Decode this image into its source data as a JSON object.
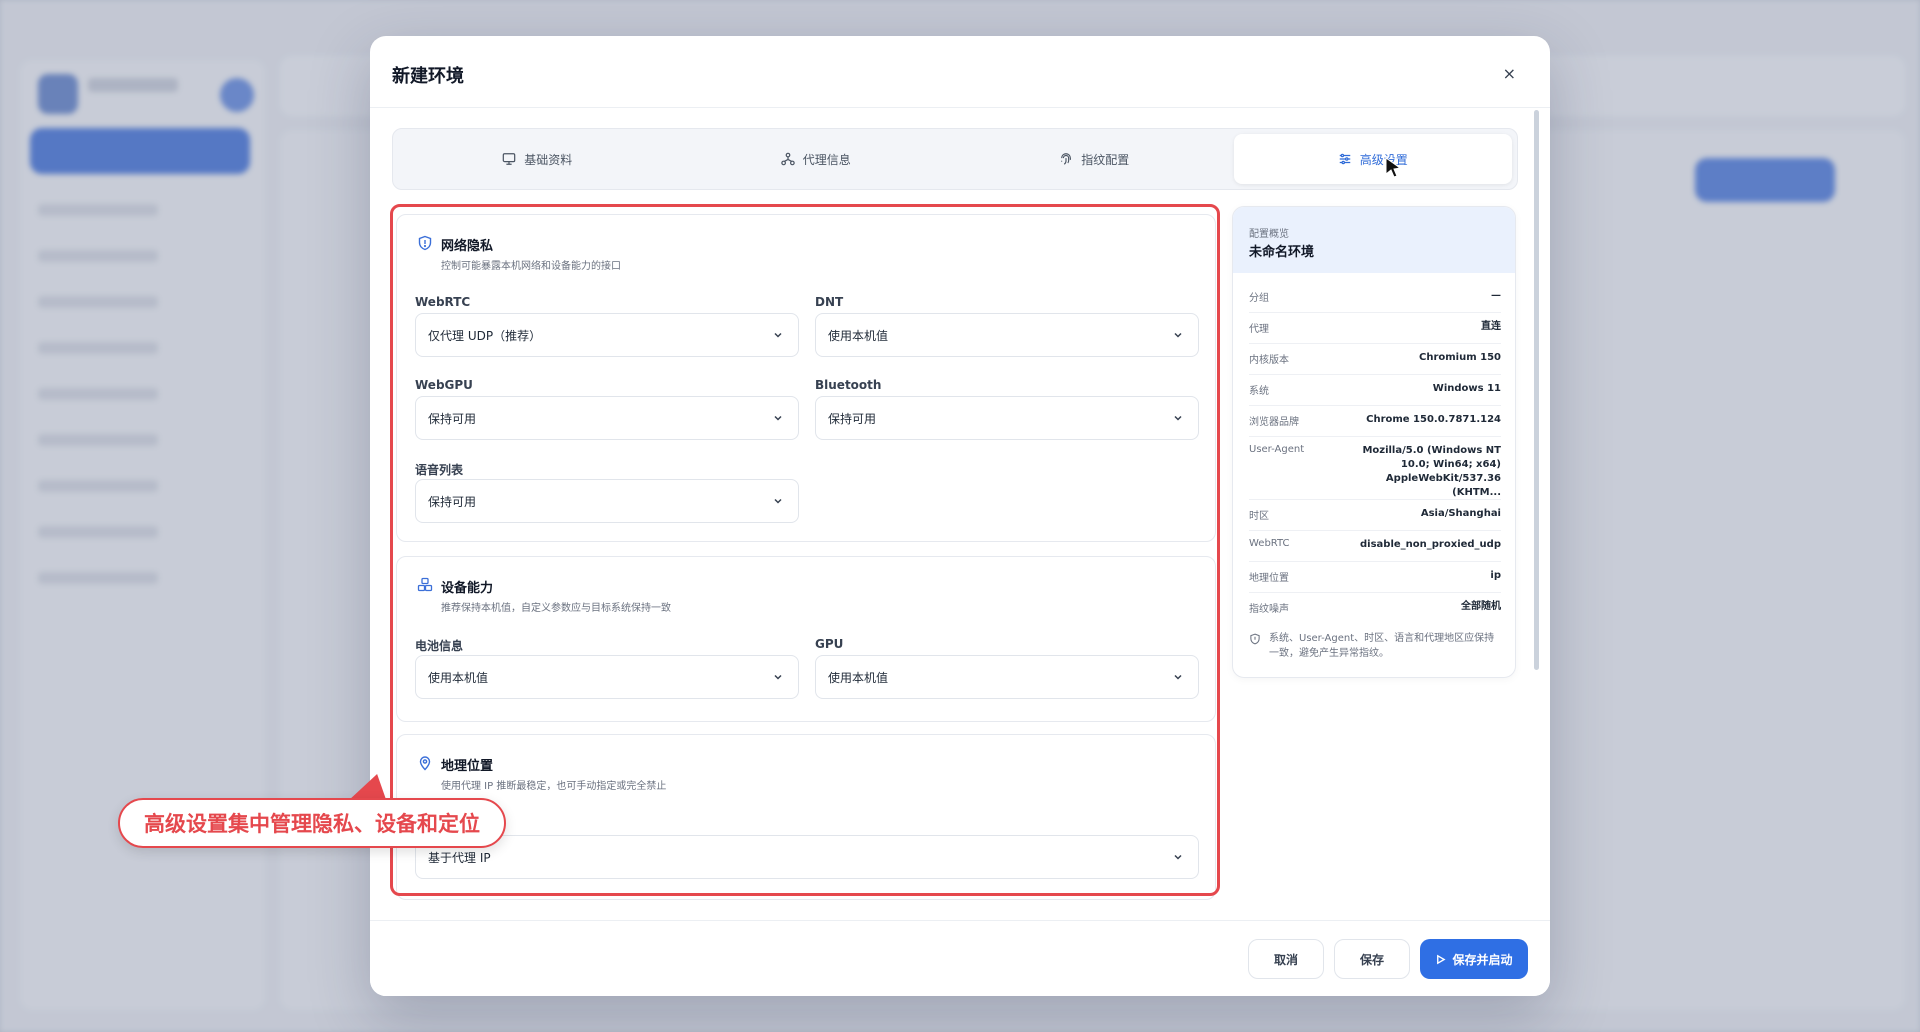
{
  "modal": {
    "title": "新建环境",
    "close_label": "×"
  },
  "tabs": [
    {
      "label": "基础资料",
      "icon": "monitor-icon"
    },
    {
      "label": "代理信息",
      "icon": "network-icon"
    },
    {
      "label": "指纹配置",
      "icon": "fingerprint-icon"
    },
    {
      "label": "高级设置",
      "icon": "sliders-icon",
      "active": true
    }
  ],
  "sections": {
    "privacy": {
      "title": "网络隐私",
      "desc": "控制可能暴露本机网络和设备能力的接口",
      "fields": {
        "webrtc": {
          "label": "WebRTC",
          "value": "仅代理 UDP（推荐）"
        },
        "dnt": {
          "label": "DNT",
          "value": "使用本机值"
        },
        "webgpu": {
          "label": "WebGPU",
          "value": "保持可用"
        },
        "bluetooth": {
          "label": "Bluetooth",
          "value": "保持可用"
        },
        "voices": {
          "label": "语音列表",
          "value": "保持可用"
        }
      }
    },
    "device": {
      "title": "设备能力",
      "desc": "推荐保持本机值，自定义参数应与目标系统保持一致",
      "fields": {
        "battery": {
          "label": "电池信息",
          "value": "使用本机值"
        },
        "gpu": {
          "label": "GPU",
          "value": "使用本机值"
        }
      }
    },
    "geo": {
      "title": "地理位置",
      "desc": "使用代理 IP 推断最稳定，也可手动指定或完全禁止",
      "fields": {
        "mode": {
          "value": "基于代理 IP"
        }
      }
    }
  },
  "callout": {
    "text": "高级设置集中管理隐私、设备和定位"
  },
  "summary": {
    "kicker": "配置概览",
    "name": "未命名环境",
    "rows": [
      {
        "k": "分组",
        "v": "—"
      },
      {
        "k": "代理",
        "v": "直连"
      },
      {
        "k": "内核版本",
        "v": "Chromium 150"
      },
      {
        "k": "系统",
        "v": "Windows 11"
      },
      {
        "k": "浏览器品牌",
        "v": "Chrome 150.0.7871.124"
      },
      {
        "k": "User-Agent",
        "v": "Mozilla/5.0 (Windows NT 10.0; Win64; x64) AppleWebKit/537.36 (KHTM..."
      },
      {
        "k": "时区",
        "v": "Asia/Shanghai"
      },
      {
        "k": "WebRTC",
        "v": "disable_non_proxied_udp"
      },
      {
        "k": "地理位置",
        "v": "ip"
      },
      {
        "k": "指纹噪声",
        "v": "全部随机"
      }
    ],
    "note": "系统、User-Agent、时区、语言和代理地区应保持一致，避免产生异常指纹。"
  },
  "footer": {
    "cancel": "取消",
    "save": "保存",
    "save_start": "保存并启动"
  },
  "colors": {
    "accent": "#2f6fe4",
    "highlight": "#e5484d",
    "summary_head": "#eaf1fd"
  }
}
